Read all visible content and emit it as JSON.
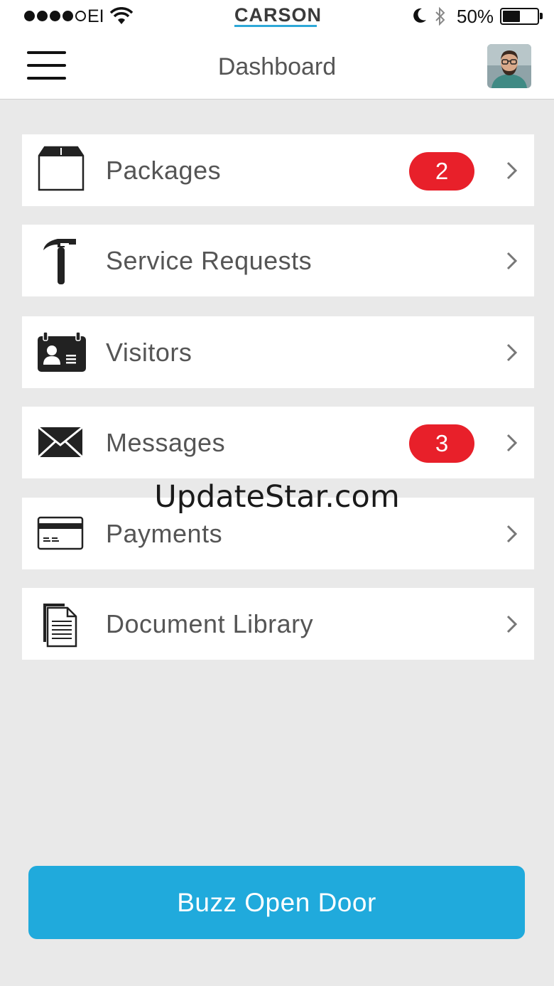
{
  "status_bar": {
    "carrier": "EI",
    "battery": "50%",
    "brand": "CARSON",
    "signal_bars_filled": 4,
    "signal_bars_total": 5,
    "battery_level": 0.5
  },
  "header": {
    "title": "Dashboard",
    "menu_icon": "hamburger-icon",
    "avatar": "user-avatar"
  },
  "menu": {
    "items": [
      {
        "label": "Packages",
        "icon": "package-box-icon",
        "badge": "2"
      },
      {
        "label": "Service Requests",
        "icon": "hammer-icon",
        "badge": null
      },
      {
        "label": "Visitors",
        "icon": "id-badge-icon",
        "badge": null
      },
      {
        "label": "Messages",
        "icon": "envelope-icon",
        "badge": "3"
      },
      {
        "label": "Payments",
        "icon": "credit-card-icon",
        "badge": null
      },
      {
        "label": "Document Library",
        "icon": "document-icon",
        "badge": null
      }
    ]
  },
  "watermark": "UpdateStar.com",
  "buzz_button": {
    "label": "Buzz Open Door"
  },
  "colors": {
    "accent": "#20aadc",
    "badge": "#e8202a",
    "background": "#e9e9e9",
    "logo_underline": "#2ea8d8"
  }
}
